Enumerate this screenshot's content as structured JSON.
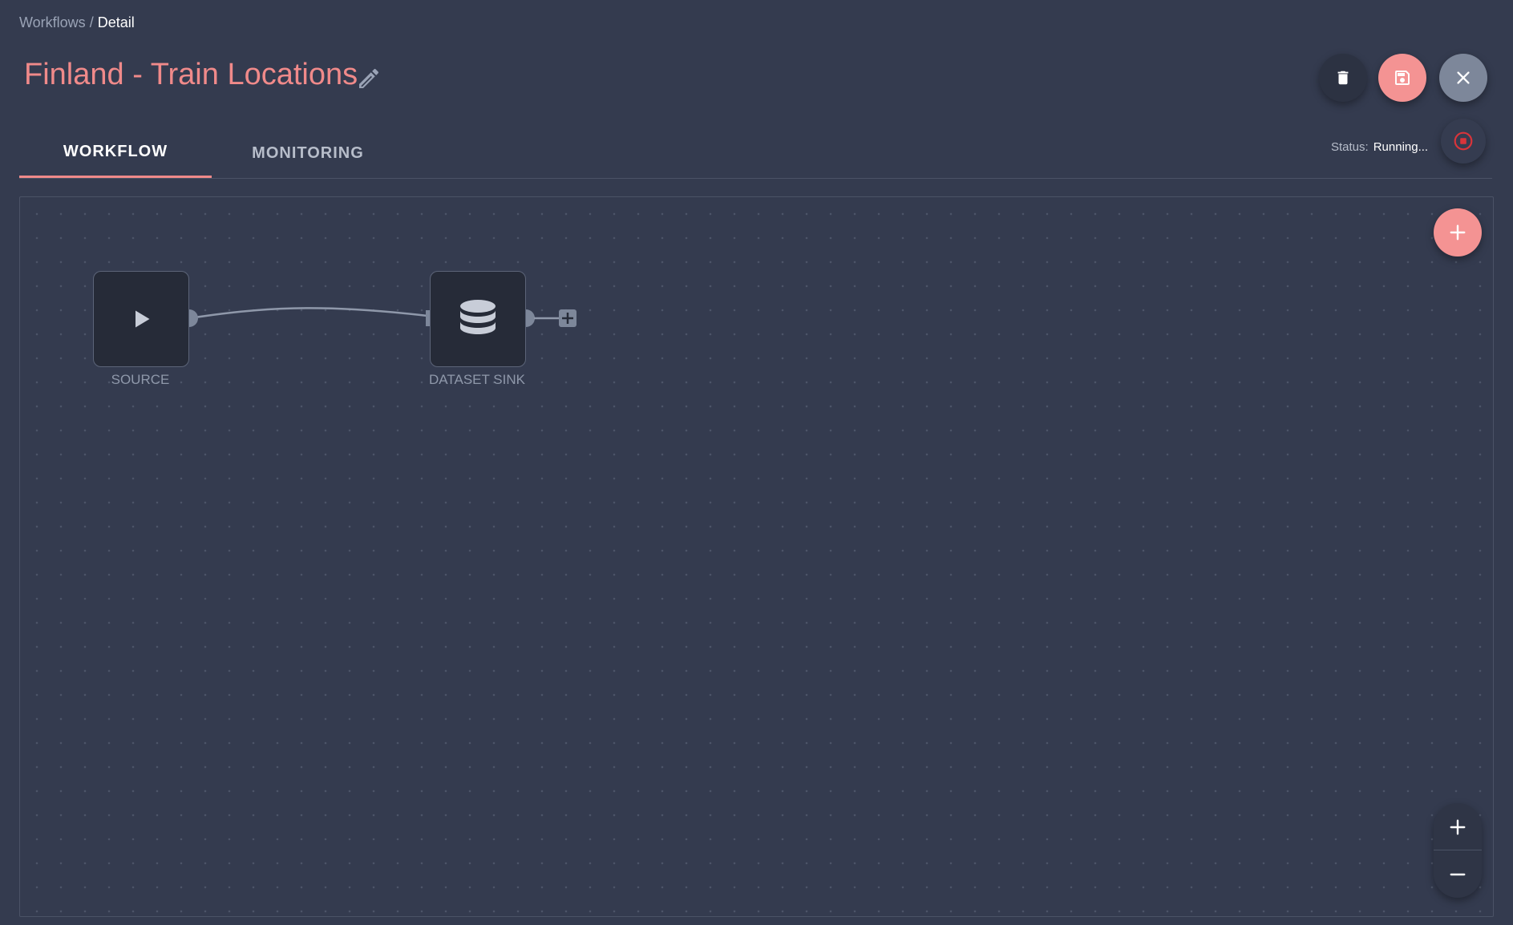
{
  "breadcrumb": {
    "parent": "Workflows",
    "separator": "/",
    "current": "Detail"
  },
  "workflow": {
    "title": "Finland - Train Locations"
  },
  "tabs": [
    {
      "label": "WORKFLOW",
      "active": true
    },
    {
      "label": "MONITORING",
      "active": false
    }
  ],
  "status": {
    "label": "Status:",
    "value": "Running..."
  },
  "nodes": [
    {
      "label": "SOURCE",
      "icon": "play-icon"
    },
    {
      "label": "DATASET SINK",
      "icon": "database-icon"
    }
  ],
  "colors": {
    "accent": "#f08a8a",
    "background": "#343b4f",
    "node": "#262b38",
    "stop": "#d9343a"
  }
}
